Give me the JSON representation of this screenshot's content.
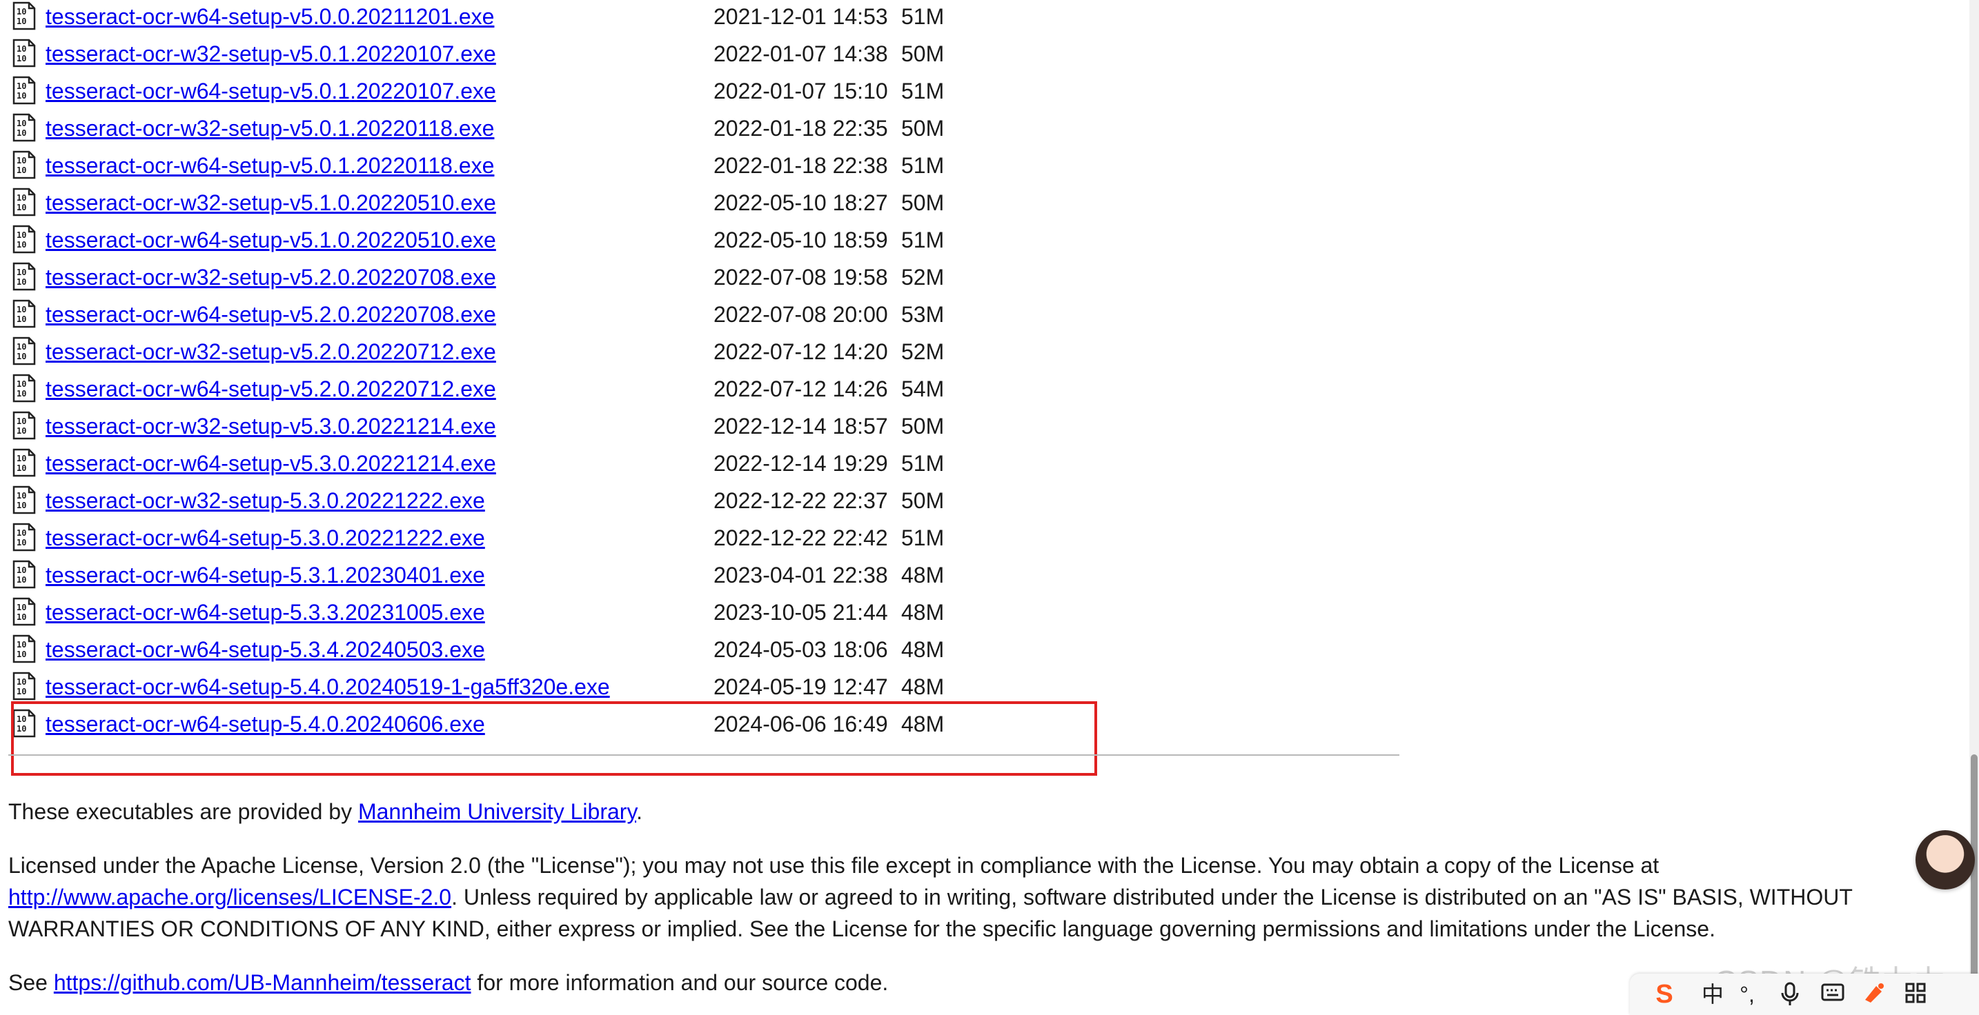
{
  "files": [
    {
      "name": "tesseract-ocr-w64-setup-v5.0.0.20211201.exe",
      "date": "2021-12-01 14:53",
      "size": "51M"
    },
    {
      "name": "tesseract-ocr-w32-setup-v5.0.1.20220107.exe",
      "date": "2022-01-07 14:38",
      "size": "50M"
    },
    {
      "name": "tesseract-ocr-w64-setup-v5.0.1.20220107.exe",
      "date": "2022-01-07 15:10",
      "size": "51M"
    },
    {
      "name": "tesseract-ocr-w32-setup-v5.0.1.20220118.exe",
      "date": "2022-01-18 22:35",
      "size": "50M"
    },
    {
      "name": "tesseract-ocr-w64-setup-v5.0.1.20220118.exe",
      "date": "2022-01-18 22:38",
      "size": "51M"
    },
    {
      "name": "tesseract-ocr-w32-setup-v5.1.0.20220510.exe",
      "date": "2022-05-10 18:27",
      "size": "50M"
    },
    {
      "name": "tesseract-ocr-w64-setup-v5.1.0.20220510.exe",
      "date": "2022-05-10 18:59",
      "size": "51M"
    },
    {
      "name": "tesseract-ocr-w32-setup-v5.2.0.20220708.exe",
      "date": "2022-07-08 19:58",
      "size": "52M"
    },
    {
      "name": "tesseract-ocr-w64-setup-v5.2.0.20220708.exe",
      "date": "2022-07-08 20:00",
      "size": "53M"
    },
    {
      "name": "tesseract-ocr-w32-setup-v5.2.0.20220712.exe",
      "date": "2022-07-12 14:20",
      "size": "52M"
    },
    {
      "name": "tesseract-ocr-w64-setup-v5.2.0.20220712.exe",
      "date": "2022-07-12 14:26",
      "size": "54M"
    },
    {
      "name": "tesseract-ocr-w32-setup-v5.3.0.20221214.exe",
      "date": "2022-12-14 18:57",
      "size": "50M"
    },
    {
      "name": "tesseract-ocr-w64-setup-v5.3.0.20221214.exe",
      "date": "2022-12-14 19:29",
      "size": "51M"
    },
    {
      "name": "tesseract-ocr-w32-setup-5.3.0.20221222.exe",
      "date": "2022-12-22 22:37",
      "size": "50M"
    },
    {
      "name": "tesseract-ocr-w64-setup-5.3.0.20221222.exe",
      "date": "2022-12-22 22:42",
      "size": "51M"
    },
    {
      "name": "tesseract-ocr-w64-setup-5.3.1.20230401.exe",
      "date": "2023-04-01 22:38",
      "size": "48M"
    },
    {
      "name": "tesseract-ocr-w64-setup-5.3.3.20231005.exe",
      "date": "2023-10-05 21:44",
      "size": "48M"
    },
    {
      "name": "tesseract-ocr-w64-setup-5.3.4.20240503.exe",
      "date": "2024-05-03 18:06",
      "size": "48M"
    },
    {
      "name": "tesseract-ocr-w64-setup-5.4.0.20240519-1-ga5ff320e.exe",
      "date": "2024-05-19 12:47",
      "size": "48M"
    },
    {
      "name": "tesseract-ocr-w64-setup-5.4.0.20240606.exe",
      "date": "2024-06-06 16:49",
      "size": "48M"
    }
  ],
  "footer": {
    "provided_prefix": "These executables are provided by ",
    "provided_link": "Mannheim University Library",
    "provided_suffix": ".",
    "license_line1": "Licensed under the Apache License, Version 2.0 (the \"License\"); you may not use this file except in compliance with the License. You may obtain a copy of the License at",
    "license_link": "http://www.apache.org/licenses/LICENSE-2.0",
    "license_line2_rest": ". Unless required by applicable law or agreed to in writing, software distributed under the License is distributed on an \"AS IS\" BASIS, WITHOUT",
    "license_line3": "WARRANTIES OR CONDITIONS OF ANY KIND, either express or implied. See the License for the specific language governing permissions and limitations under the License.",
    "see_prefix": "See ",
    "see_link": "https://github.com/UB-Mannheim/tesseract",
    "see_suffix": " for more information and our source code."
  },
  "ime": {
    "logo": "S",
    "lang": "中",
    "punct": "°,",
    "mic_icon": "microphone-icon",
    "keyboard_icon": "keyboard-icon",
    "skin_icon": "skin-icon",
    "grid_icon": "grid-icon"
  },
  "watermark": "CSDN @铁力力",
  "colors": {
    "link": "#0000ee",
    "highlight": "#e02020"
  }
}
